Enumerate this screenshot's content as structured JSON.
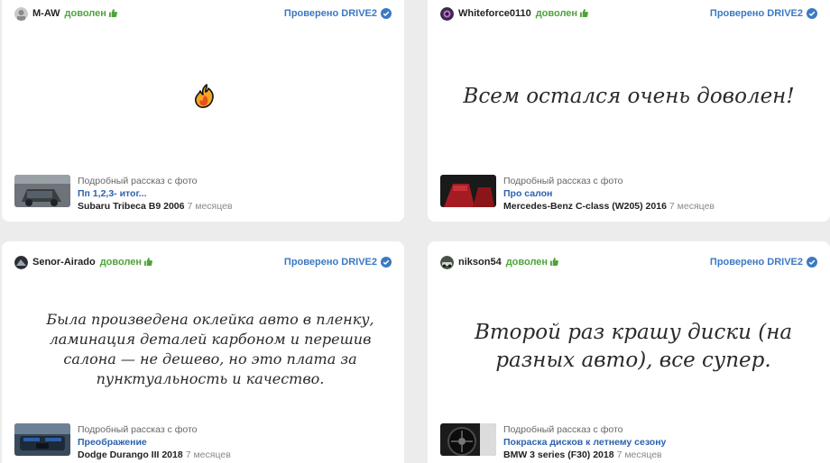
{
  "common": {
    "verified_label": "Проверено DRIVE2",
    "subtitle": "Подробный рассказ с фото",
    "happy_label": "доволен"
  },
  "colors": {
    "accent": "#3b79c3",
    "happy": "#4da33b",
    "link": "#2c61ad"
  },
  "cards": [
    {
      "user": "M-AW",
      "quote": "",
      "emoji": "flame-icon",
      "post_title": "Пп 1,2,3- итог...",
      "car": "Subaru Tribeca B9 2006",
      "age": "7 месяцев"
    },
    {
      "user": "Whiteforce0110",
      "quote": "Всем остался очень доволен!",
      "post_title": "Про салон",
      "car": "Mercedes-Benz C-class (W205) 2016",
      "age": "7 месяцев"
    },
    {
      "user": "Senor-Airado",
      "quote": "Была произведена оклейка авто в пленку, ламинация деталей карбоном и перешив салона — не дешево, но это плата за пунктуальность и качество.",
      "post_title": "Преображение",
      "car": "Dodge Durango III 2018",
      "age": "7 месяцев"
    },
    {
      "user": "nikson54",
      "quote": "Второй раз крашу диски (на разных авто), все супер.",
      "post_title": "Покраска дисков к летнему сезону",
      "car": "BMW 3 series (F30) 2018",
      "age": "7 месяцев"
    }
  ]
}
